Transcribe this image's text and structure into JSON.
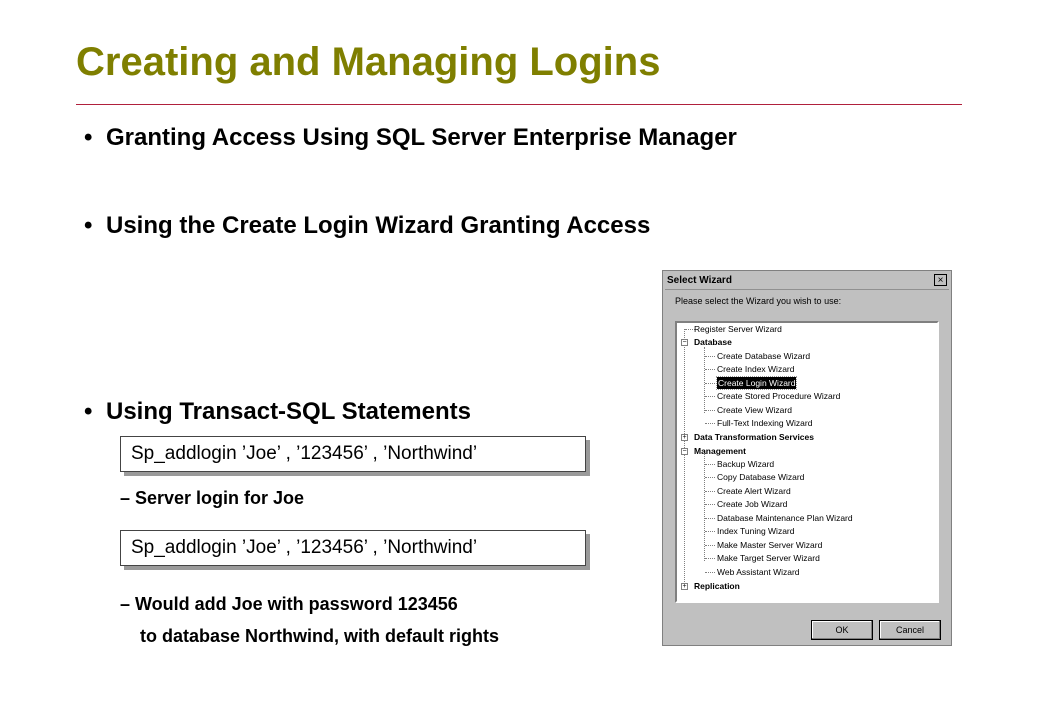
{
  "slide": {
    "title": "Creating and Managing Logins",
    "bullets": [
      "Granting Access Using SQL Server Enterprise Manager",
      "Using the Create Login Wizard Granting Access",
      "Using Transact-SQL Statements"
    ],
    "bullet_symbol": "•",
    "code1": "Sp_addlogin ’Joe’ , ’123456’ , ’Northwind’",
    "note1": "– Server login for Joe",
    "code2": "Sp_addlogin ’Joe’ , ’123456’ , ’Northwind’",
    "note2_line1": "– Would add Joe with password 123456",
    "note2_line2": "to database Northwind, with default rights"
  },
  "dialog": {
    "title": "Select Wizard",
    "close_glyph": "×",
    "prompt": "Please select the Wizard you wish to use:",
    "tree": {
      "register": "Register Server Wizard",
      "database": "Database",
      "db_items": [
        "Create Database Wizard",
        "Create Index Wizard",
        "Create Login Wizard",
        "Create Stored Procedure Wizard",
        "Create View Wizard",
        "Full-Text Indexing Wizard"
      ],
      "dts": "Data Transformation Services",
      "management": "Management",
      "mgmt_items": [
        "Backup Wizard",
        "Copy Database Wizard",
        "Create Alert Wizard",
        "Create Job Wizard",
        "Database Maintenance Plan Wizard",
        "Index Tuning Wizard",
        "Make Master Server Wizard",
        "Make Target Server Wizard",
        "Web Assistant Wizard"
      ],
      "replication": "Replication",
      "expanded_glyph": "−",
      "collapsed_glyph": "+"
    },
    "ok_label": "OK",
    "cancel_label": "Cancel"
  },
  "colors": {
    "title": "#7f7f00",
    "rule": "#b0203c",
    "selection": "#000000"
  }
}
